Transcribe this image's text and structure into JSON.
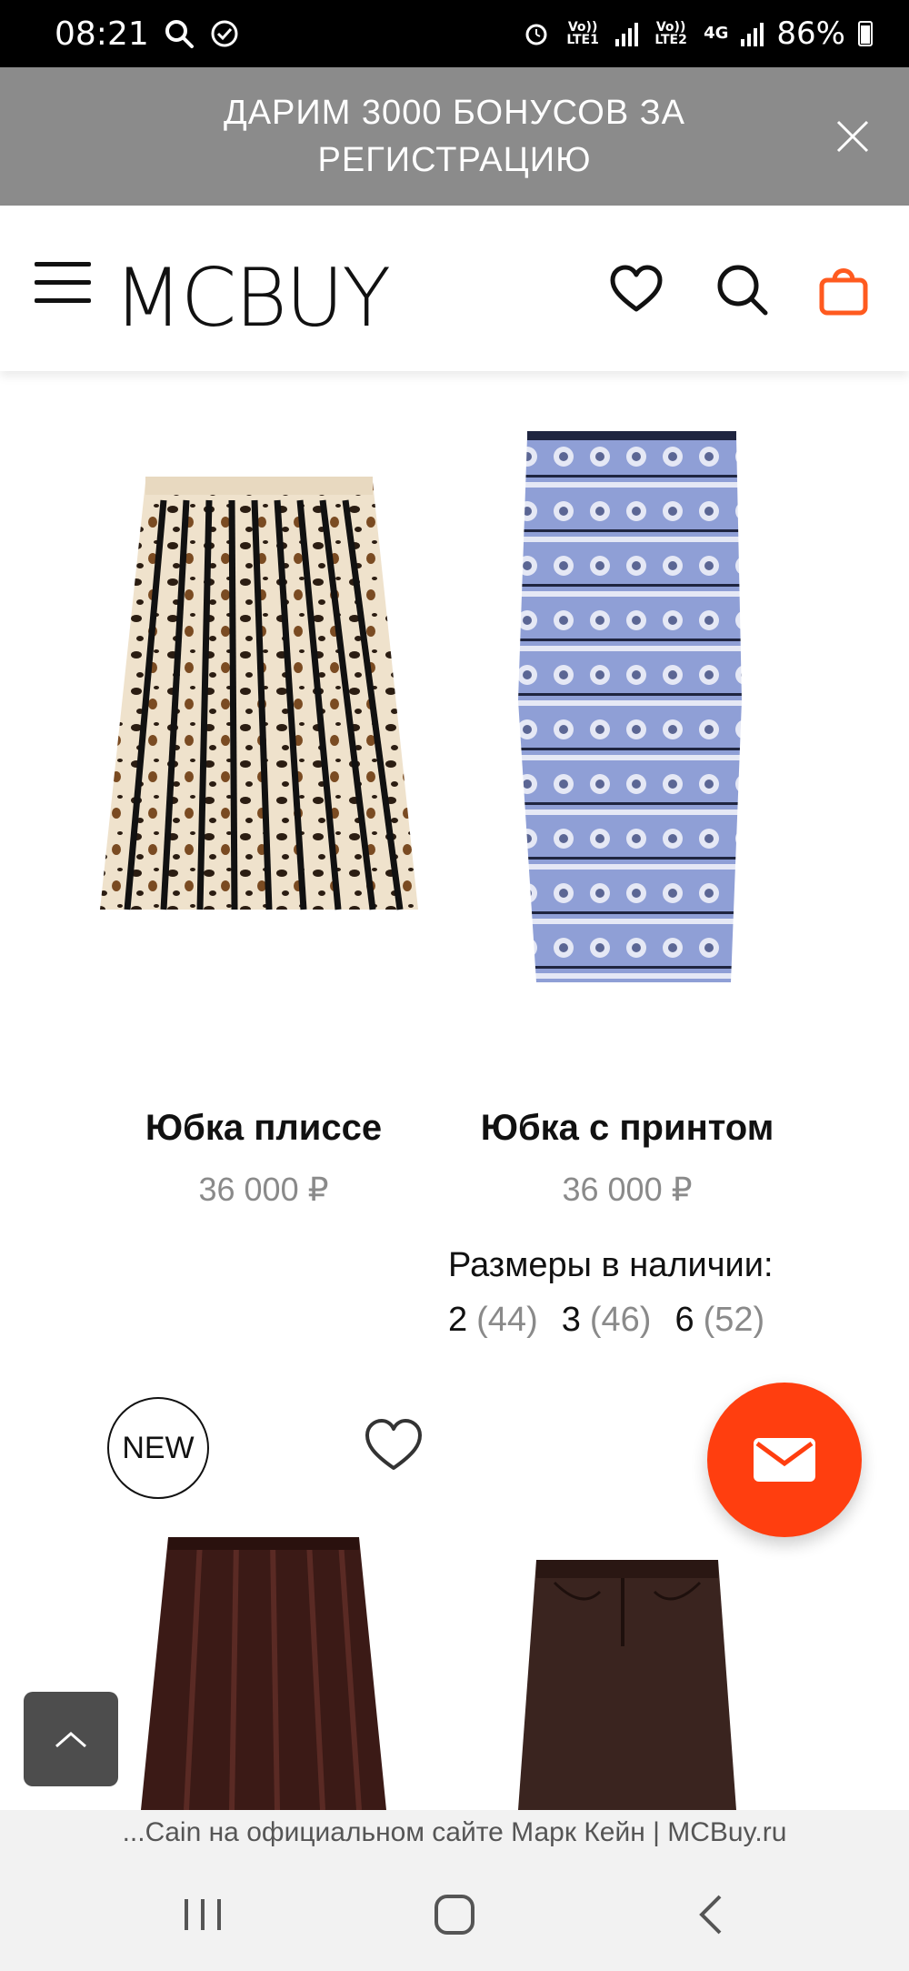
{
  "status_bar": {
    "time": "08:21",
    "lte1": "Vo)) LTE1",
    "lte2": "Vo)) LTE2",
    "net": "4G",
    "battery": "86%"
  },
  "promo": {
    "text": "ДАРИМ 3000 БОНУСОВ ЗА РЕГИСТРАЦИЮ"
  },
  "header": {
    "logo": "MCBUY",
    "icons": [
      "menu-icon",
      "heart-icon",
      "search-icon",
      "bag-icon"
    ],
    "accent": "#ff5a1f"
  },
  "products": [
    {
      "name": "Юбка плиссе",
      "price": "36 000 ₽"
    },
    {
      "name": "Юбка с принтом",
      "price": "36 000 ₽",
      "sizes_title": "Размеры в наличии:",
      "sizes": [
        {
          "num": "2",
          "ru": "(44)"
        },
        {
          "num": "3",
          "ru": "(46)"
        },
        {
          "num": "6",
          "ru": "(52)"
        }
      ]
    }
  ],
  "badge": {
    "new": "NEW"
  },
  "fab_color": "#ff3e0f",
  "url_bar": {
    "text": "...Cain на официальном сайте Марк Кейн | MCBuy.ru"
  }
}
